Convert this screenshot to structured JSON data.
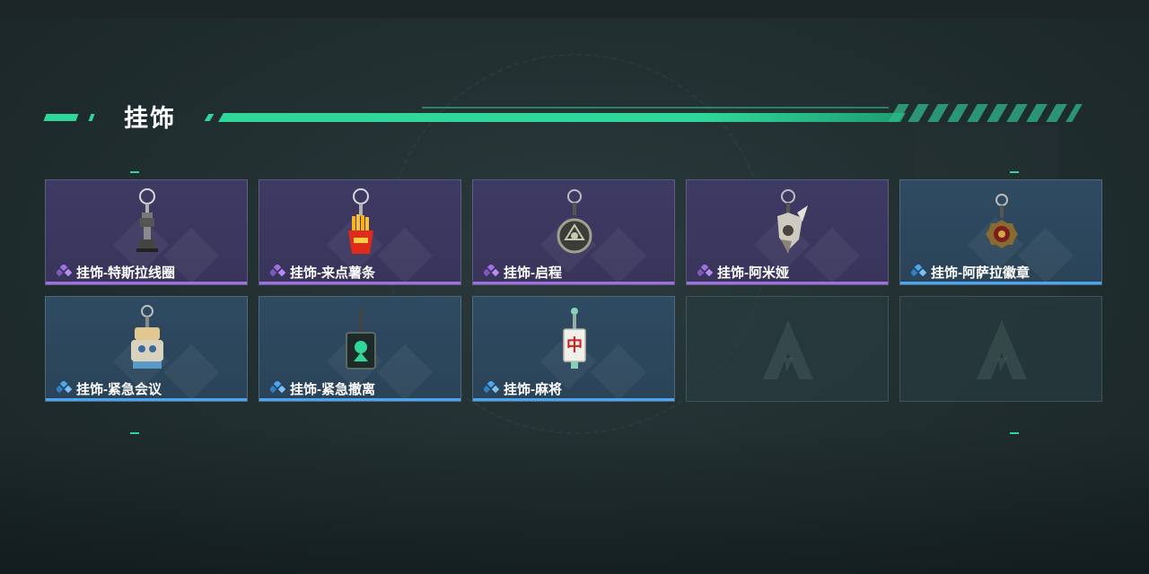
{
  "section": {
    "title": "挂饰"
  },
  "colors": {
    "accent": "#2fd89a",
    "rare_purple": "#a070e0",
    "rare_blue": "#4aa6f0"
  },
  "cards": [
    {
      "label": "挂饰-特斯拉线圈",
      "rarity": "purple",
      "icon": "tesla-coil-charm-icon"
    },
    {
      "label": "挂饰-来点薯条",
      "rarity": "purple",
      "icon": "fries-charm-icon"
    },
    {
      "label": "挂饰-启程",
      "rarity": "purple",
      "icon": "journey-medallion-charm-icon"
    },
    {
      "label": "挂饰-阿米娅",
      "rarity": "purple",
      "icon": "amiya-charm-icon"
    },
    {
      "label": "挂饰-阿萨拉徽章",
      "rarity": "blue",
      "icon": "ahsarah-badge-charm-icon"
    },
    {
      "label": "挂饰-紧急会议",
      "rarity": "blue",
      "icon": "emergency-meeting-charm-icon"
    },
    {
      "label": "挂饰-紧急撤离",
      "rarity": "blue",
      "icon": "emergency-evac-charm-icon"
    },
    {
      "label": "挂饰-麻将",
      "rarity": "blue",
      "icon": "mahjong-tile-charm-icon",
      "tile_glyph": "中"
    },
    {
      "label": "",
      "rarity": "empty",
      "icon": "empty-slot-logo-icon"
    },
    {
      "label": "",
      "rarity": "empty",
      "icon": "empty-slot-logo-icon"
    }
  ]
}
